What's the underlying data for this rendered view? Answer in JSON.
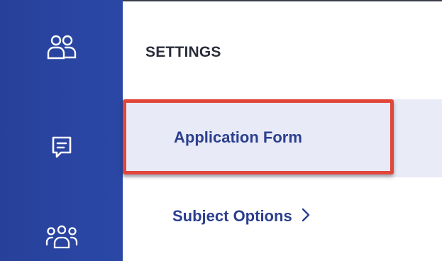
{
  "header": {
    "title": "SETTINGS"
  },
  "rail": {
    "items": [
      {
        "icon": "users-icon"
      },
      {
        "icon": "message-icon"
      },
      {
        "icon": "group-icon"
      }
    ]
  },
  "menu": {
    "items": [
      {
        "label": "Application Form",
        "active": true
      },
      {
        "label": "Subject Options",
        "has_submenu": true
      }
    ]
  },
  "colors": {
    "rail": "#2a46a3",
    "active_bg": "#e8ebf7",
    "highlight_border": "#e2463a",
    "link_text": "#2b3f8e",
    "title_text": "#2a2d3a"
  }
}
